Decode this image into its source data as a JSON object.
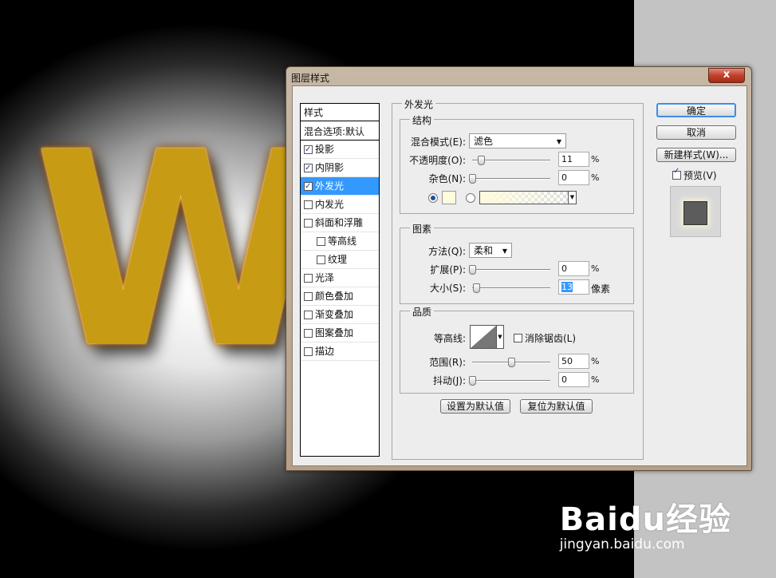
{
  "canvas": {
    "letter": "W",
    "watermark": {
      "logo": "Baidu经验",
      "url": "jingyan.baidu.com"
    }
  },
  "dialog": {
    "title": "图层样式",
    "close_label": "x",
    "styles_list": {
      "header": "样式",
      "blend_options": "混合选项:默认",
      "items": [
        {
          "label": "投影",
          "checked": true
        },
        {
          "label": "内阴影",
          "checked": true
        },
        {
          "label": "外发光",
          "checked": true,
          "selected": true
        },
        {
          "label": "内发光",
          "checked": false
        },
        {
          "label": "斜面和浮雕",
          "checked": false
        },
        {
          "label": "等高线",
          "checked": false,
          "indent": true
        },
        {
          "label": "纹理",
          "checked": false,
          "indent": true
        },
        {
          "label": "光泽",
          "checked": false
        },
        {
          "label": "颜色叠加",
          "checked": false
        },
        {
          "label": "渐变叠加",
          "checked": false
        },
        {
          "label": "图案叠加",
          "checked": false
        },
        {
          "label": "描边",
          "checked": false
        }
      ]
    },
    "panel_title": "外发光",
    "structure": {
      "title": "结构",
      "blend_mode_label": "混合模式(E):",
      "blend_mode_value": "滤色",
      "opacity_label": "不透明度(O):",
      "opacity_value": "11",
      "opacity_unit": "%",
      "opacity_level": 0.11,
      "noise_label": "杂色(N):",
      "noise_value": "0",
      "noise_unit": "%",
      "noise_level": 0,
      "glow_color": "#fffbdc"
    },
    "elements": {
      "title": "图素",
      "technique_label": "方法(Q):",
      "technique_value": "柔和",
      "spread_label": "扩展(P):",
      "spread_value": "0",
      "spread_unit": "%",
      "spread_level": 0,
      "size_label": "大小(S):",
      "size_value": "13",
      "size_unit": "像素",
      "size_level": 0.05
    },
    "quality": {
      "title": "品质",
      "contour_label": "等高线:",
      "antialias_label": "消除锯齿(L)",
      "antialias_checked": false,
      "range_label": "范围(R):",
      "range_value": "50",
      "range_unit": "%",
      "range_level": 0.5,
      "jitter_label": "抖动(J):",
      "jitter_value": "0",
      "jitter_unit": "%",
      "jitter_level": 0
    },
    "make_default_label": "设置为默认值",
    "reset_default_label": "复位为默认值",
    "ok_label": "确定",
    "cancel_label": "取消",
    "new_style_label": "新建样式(W)...",
    "preview_label": "预览(V)",
    "preview_checked": true
  }
}
